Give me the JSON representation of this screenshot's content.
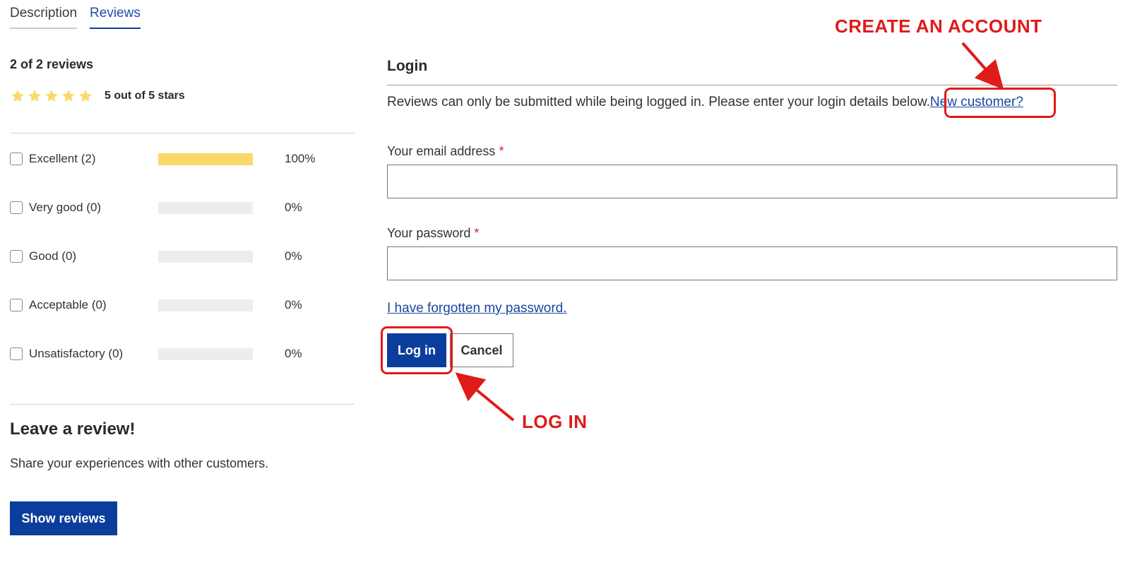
{
  "tabs": [
    {
      "label": "Description",
      "active": false
    },
    {
      "label": "Reviews",
      "active": true
    }
  ],
  "summary": {
    "review_count": "2 of 2 reviews",
    "stars_label": "5 out of 5 stars",
    "average_stars": 5,
    "star_color": "#fad96b"
  },
  "ratings": [
    {
      "label": "Excellent (2)",
      "percent_text": "100%",
      "fraction": 1.0
    },
    {
      "label": "Very good (0)",
      "percent_text": "0%",
      "fraction": 0
    },
    {
      "label": "Good (0)",
      "percent_text": "0%",
      "fraction": 0
    },
    {
      "label": "Acceptable (0)",
      "percent_text": "0%",
      "fraction": 0
    },
    {
      "label": "Unsatisfactory (0)",
      "percent_text": "0%",
      "fraction": 0
    }
  ],
  "leave": {
    "title": "Leave a review!",
    "text": "Share your experiences with other customers.",
    "button": "Show reviews"
  },
  "login": {
    "title": "Login",
    "info": "Reviews can only be submitted while being logged in. Please enter your login details below.",
    "new_customer": "New customer?",
    "email_label": "Your email address",
    "password_label": "Your password",
    "required_mark": "*",
    "email_value": "",
    "password_value": "",
    "forgot": "I have forgotten my password.",
    "login_button": "Log in",
    "cancel_button": "Cancel"
  },
  "annotations": {
    "create_account": "CREATE AN ACCOUNT",
    "log_in": "LOG IN",
    "color": "#e11a1a"
  },
  "colors": {
    "primary": "#0b3e9c",
    "link": "#1a47a0",
    "bar_fill": "#fad96b",
    "bar_track": "#ededed"
  }
}
